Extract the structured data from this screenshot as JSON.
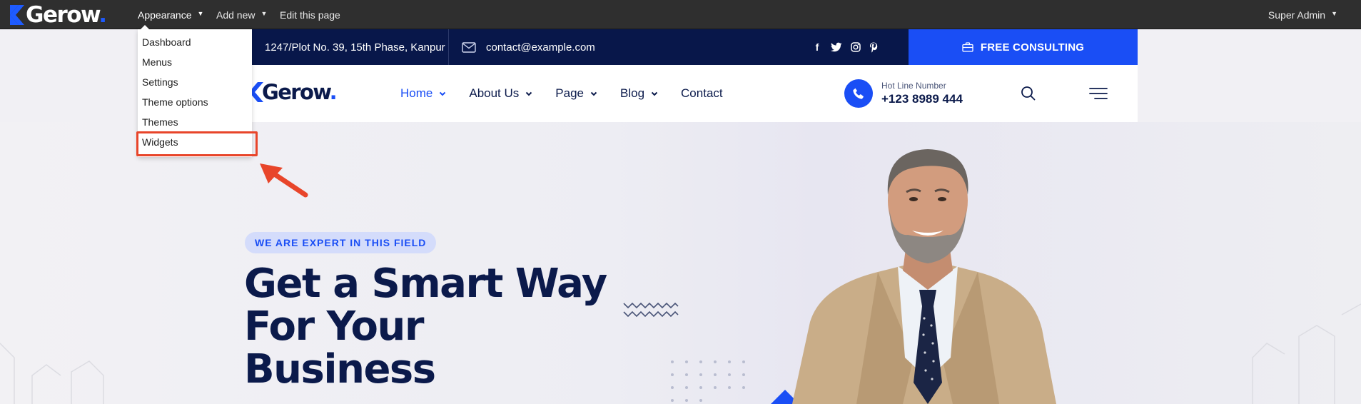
{
  "admin_bar": {
    "logo_text": "Gerow",
    "logo_dot": ".",
    "menu": {
      "appearance": "Appearance",
      "add_new": "Add new",
      "edit_page": "Edit this page",
      "user": "Super Admin"
    },
    "dropdown": [
      "Dashboard",
      "Menus",
      "Settings",
      "Theme options",
      "Themes",
      "Widgets"
    ],
    "highlighted_item": "Widgets",
    "colors": {
      "bar": "#2f2f2f",
      "highlight": "#e8452a",
      "brand": "#1e5bff"
    }
  },
  "info_strip": {
    "address": "1247/Plot No. 39, 15th Phase, Kanpur",
    "email": "contact@example.com",
    "socials": [
      "facebook-icon",
      "twitter-icon",
      "instagram-icon",
      "pinterest-icon"
    ],
    "cta": "FREE CONSULTING",
    "colors": {
      "strip": "#08174a",
      "cta": "#1a4ef5"
    }
  },
  "header": {
    "logo_text": "Gerow",
    "logo_dot": ".",
    "nav": [
      {
        "label": "Home",
        "dropdown": true,
        "active": true
      },
      {
        "label": "About Us",
        "dropdown": true,
        "active": false
      },
      {
        "label": "Page",
        "dropdown": true,
        "active": false
      },
      {
        "label": "Blog",
        "dropdown": true,
        "active": false
      },
      {
        "label": "Contact",
        "dropdown": false,
        "active": false
      }
    ],
    "hotline_label": "Hot Line Number",
    "hotline_number": "+123 8989 444"
  },
  "hero": {
    "badge": "WE ARE EXPERT IN THIS FIELD",
    "title_line1": "Get a Smart Way",
    "title_line2": "For Your",
    "title_line3": "Business",
    "colors": {
      "title": "#0b1a4b",
      "badge_bg": "#d4dcfb"
    }
  }
}
